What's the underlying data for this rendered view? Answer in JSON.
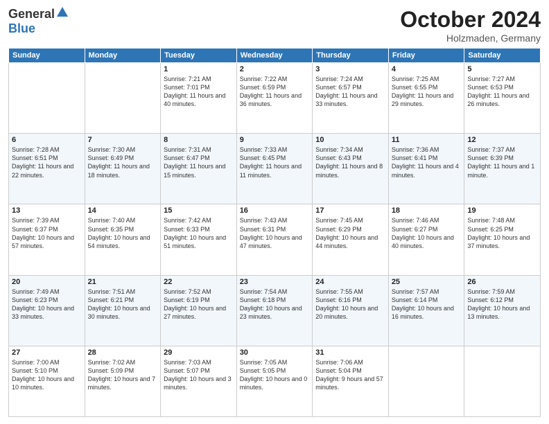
{
  "logo": {
    "general": "General",
    "blue": "Blue"
  },
  "title": {
    "month": "October 2024",
    "location": "Holzmaden, Germany"
  },
  "headers": [
    "Sunday",
    "Monday",
    "Tuesday",
    "Wednesday",
    "Thursday",
    "Friday",
    "Saturday"
  ],
  "weeks": [
    [
      {
        "day": "",
        "info": ""
      },
      {
        "day": "",
        "info": ""
      },
      {
        "day": "1",
        "info": "Sunrise: 7:21 AM\nSunset: 7:01 PM\nDaylight: 11 hours and 40 minutes."
      },
      {
        "day": "2",
        "info": "Sunrise: 7:22 AM\nSunset: 6:59 PM\nDaylight: 11 hours and 36 minutes."
      },
      {
        "day": "3",
        "info": "Sunrise: 7:24 AM\nSunset: 6:57 PM\nDaylight: 11 hours and 33 minutes."
      },
      {
        "day": "4",
        "info": "Sunrise: 7:25 AM\nSunset: 6:55 PM\nDaylight: 11 hours and 29 minutes."
      },
      {
        "day": "5",
        "info": "Sunrise: 7:27 AM\nSunset: 6:53 PM\nDaylight: 11 hours and 26 minutes."
      }
    ],
    [
      {
        "day": "6",
        "info": "Sunrise: 7:28 AM\nSunset: 6:51 PM\nDaylight: 11 hours and 22 minutes."
      },
      {
        "day": "7",
        "info": "Sunrise: 7:30 AM\nSunset: 6:49 PM\nDaylight: 11 hours and 18 minutes."
      },
      {
        "day": "8",
        "info": "Sunrise: 7:31 AM\nSunset: 6:47 PM\nDaylight: 11 hours and 15 minutes."
      },
      {
        "day": "9",
        "info": "Sunrise: 7:33 AM\nSunset: 6:45 PM\nDaylight: 11 hours and 11 minutes."
      },
      {
        "day": "10",
        "info": "Sunrise: 7:34 AM\nSunset: 6:43 PM\nDaylight: 11 hours and 8 minutes."
      },
      {
        "day": "11",
        "info": "Sunrise: 7:36 AM\nSunset: 6:41 PM\nDaylight: 11 hours and 4 minutes."
      },
      {
        "day": "12",
        "info": "Sunrise: 7:37 AM\nSunset: 6:39 PM\nDaylight: 11 hours and 1 minute."
      }
    ],
    [
      {
        "day": "13",
        "info": "Sunrise: 7:39 AM\nSunset: 6:37 PM\nDaylight: 10 hours and 57 minutes."
      },
      {
        "day": "14",
        "info": "Sunrise: 7:40 AM\nSunset: 6:35 PM\nDaylight: 10 hours and 54 minutes."
      },
      {
        "day": "15",
        "info": "Sunrise: 7:42 AM\nSunset: 6:33 PM\nDaylight: 10 hours and 51 minutes."
      },
      {
        "day": "16",
        "info": "Sunrise: 7:43 AM\nSunset: 6:31 PM\nDaylight: 10 hours and 47 minutes."
      },
      {
        "day": "17",
        "info": "Sunrise: 7:45 AM\nSunset: 6:29 PM\nDaylight: 10 hours and 44 minutes."
      },
      {
        "day": "18",
        "info": "Sunrise: 7:46 AM\nSunset: 6:27 PM\nDaylight: 10 hours and 40 minutes."
      },
      {
        "day": "19",
        "info": "Sunrise: 7:48 AM\nSunset: 6:25 PM\nDaylight: 10 hours and 37 minutes."
      }
    ],
    [
      {
        "day": "20",
        "info": "Sunrise: 7:49 AM\nSunset: 6:23 PM\nDaylight: 10 hours and 33 minutes."
      },
      {
        "day": "21",
        "info": "Sunrise: 7:51 AM\nSunset: 6:21 PM\nDaylight: 10 hours and 30 minutes."
      },
      {
        "day": "22",
        "info": "Sunrise: 7:52 AM\nSunset: 6:19 PM\nDaylight: 10 hours and 27 minutes."
      },
      {
        "day": "23",
        "info": "Sunrise: 7:54 AM\nSunset: 6:18 PM\nDaylight: 10 hours and 23 minutes."
      },
      {
        "day": "24",
        "info": "Sunrise: 7:55 AM\nSunset: 6:16 PM\nDaylight: 10 hours and 20 minutes."
      },
      {
        "day": "25",
        "info": "Sunrise: 7:57 AM\nSunset: 6:14 PM\nDaylight: 10 hours and 16 minutes."
      },
      {
        "day": "26",
        "info": "Sunrise: 7:59 AM\nSunset: 6:12 PM\nDaylight: 10 hours and 13 minutes."
      }
    ],
    [
      {
        "day": "27",
        "info": "Sunrise: 7:00 AM\nSunset: 5:10 PM\nDaylight: 10 hours and 10 minutes."
      },
      {
        "day": "28",
        "info": "Sunrise: 7:02 AM\nSunset: 5:09 PM\nDaylight: 10 hours and 7 minutes."
      },
      {
        "day": "29",
        "info": "Sunrise: 7:03 AM\nSunset: 5:07 PM\nDaylight: 10 hours and 3 minutes."
      },
      {
        "day": "30",
        "info": "Sunrise: 7:05 AM\nSunset: 5:05 PM\nDaylight: 10 hours and 0 minutes."
      },
      {
        "day": "31",
        "info": "Sunrise: 7:06 AM\nSunset: 5:04 PM\nDaylight: 9 hours and 57 minutes."
      },
      {
        "day": "",
        "info": ""
      },
      {
        "day": "",
        "info": ""
      }
    ]
  ]
}
